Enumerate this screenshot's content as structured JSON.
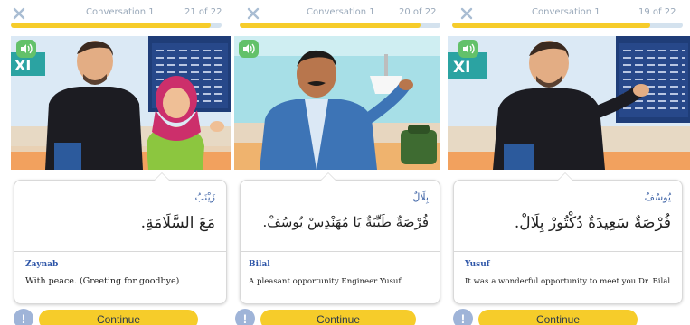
{
  "panels": [
    {
      "header": {
        "title": "Conversation 1",
        "count": "21 of 22",
        "progress": 0.95
      },
      "speaker_ar": "زَيْنَبُ",
      "line_ar": "مَعَ السَّلَامَةِ.",
      "speaker_en": "Zaynab",
      "line_en": "With peace. (Greeting for goodbye)",
      "continue_label": "Continue",
      "hint_label": "!"
    },
    {
      "header": {
        "title": "Conversation 1",
        "count": "20 of 22",
        "progress": 0.9
      },
      "speaker_ar": "بِلَالٌ",
      "line_ar": "فُرْصَةٌ طَيِّبَةٌ يَا مُهَنْدِسْ يُوسُفْ.",
      "speaker_en": "Bilal",
      "line_en": "A pleasant opportunity Engineer Yusuf.",
      "continue_label": "Continue",
      "hint_label": "!"
    },
    {
      "header": {
        "title": "Conversation 1",
        "count": "19 of 22",
        "progress": 0.86
      },
      "speaker_ar": "يُوسُفُ",
      "line_ar": "فُرْصَةٌ سَعِيدَةٌ دُكْتُورْ بِلَالْ.",
      "speaker_en": "Yusuf",
      "line_en": "It was a wonderful opportunity to meet you Dr. Bilal",
      "continue_label": "Continue",
      "hint_label": "!"
    }
  ],
  "colors": {
    "accent_yellow": "#f6cc2a",
    "link_blue": "#2d55a8",
    "progress_track": "#d4e2ee"
  },
  "icons": [
    "close-icon",
    "speaker-icon",
    "info-icon"
  ]
}
